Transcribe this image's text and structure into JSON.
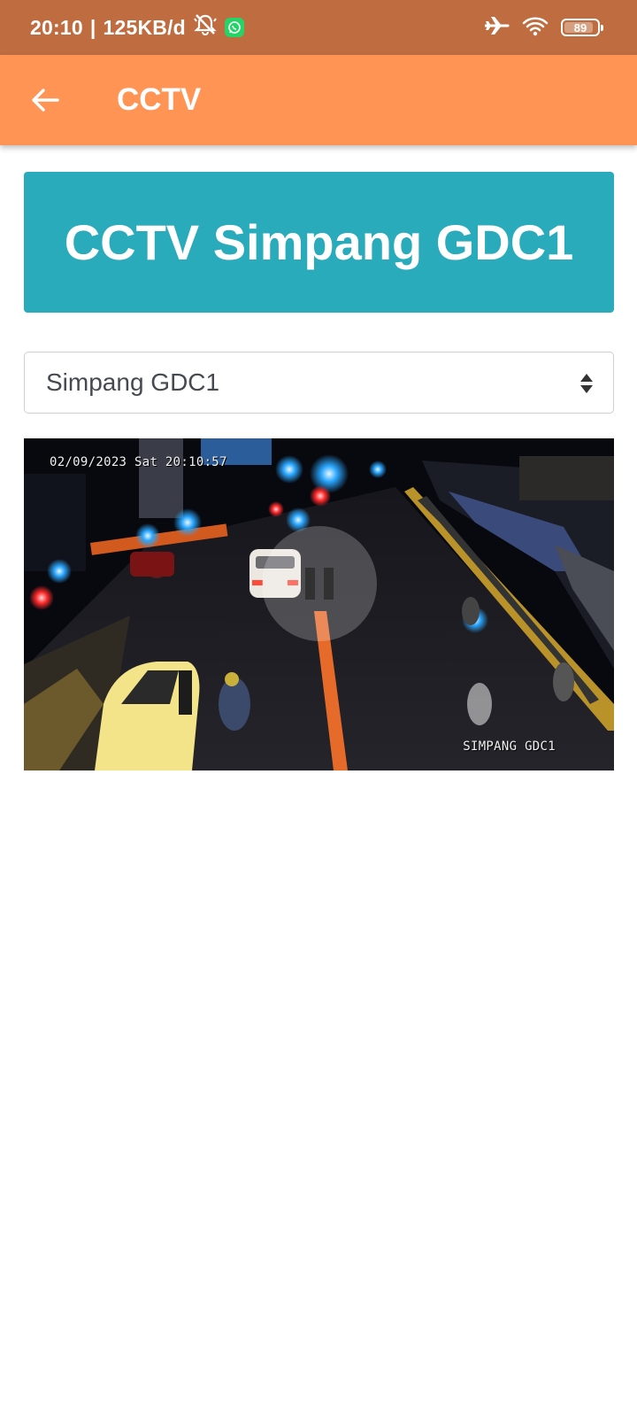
{
  "status_bar": {
    "time": "20:10",
    "separator": "|",
    "network_speed": "125KB/d",
    "battery": "89",
    "battery_level": 0.89,
    "icons": [
      "mute-bell-icon",
      "whatsapp-icon",
      "airplane-icon",
      "wifi-icon",
      "battery-icon"
    ]
  },
  "app_bar": {
    "title": "CCTV",
    "back_icon": "arrow-left-icon"
  },
  "banner": {
    "title": "CCTV Simpang GDC1"
  },
  "camera_select": {
    "selected": "Simpang GDC1",
    "icon": "sort-arrows-icon"
  },
  "video": {
    "timestamp": "02/09/2023 Sat 20:10:57",
    "camera_label": "SIMPANG GDC1",
    "state_icon": "pause-icon"
  },
  "colors": {
    "status_bar": "#bf6c40",
    "app_bar": "#ff9455",
    "banner": "#29abbc",
    "select_border": "#cfcfcf",
    "text_on_accent": "#ffffff"
  }
}
